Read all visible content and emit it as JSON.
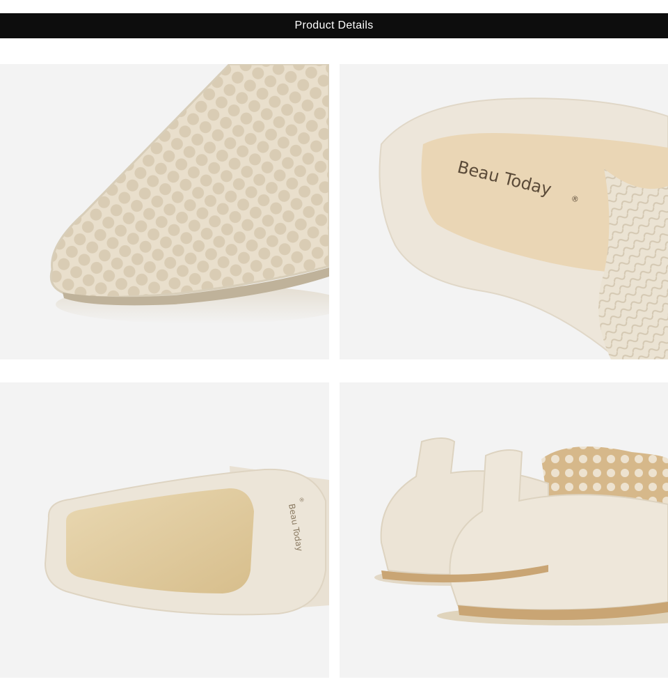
{
  "header": {
    "title": "Product Details"
  },
  "panels": [
    {
      "name": "woven-toe-closeup"
    },
    {
      "name": "insole-brand-closeup",
      "brand_text": "Beau Today",
      "brand_mark": "®"
    },
    {
      "name": "outsole-view",
      "sole_brand_text": "Beau Today",
      "sole_brand_mark": "®"
    },
    {
      "name": "heel-back-view"
    }
  ],
  "colors": {
    "header_bg": "#0d0d0d",
    "panel_bg": "#f3f3f3",
    "leather": "#ece4d6",
    "sole": "#e6d2a8"
  }
}
